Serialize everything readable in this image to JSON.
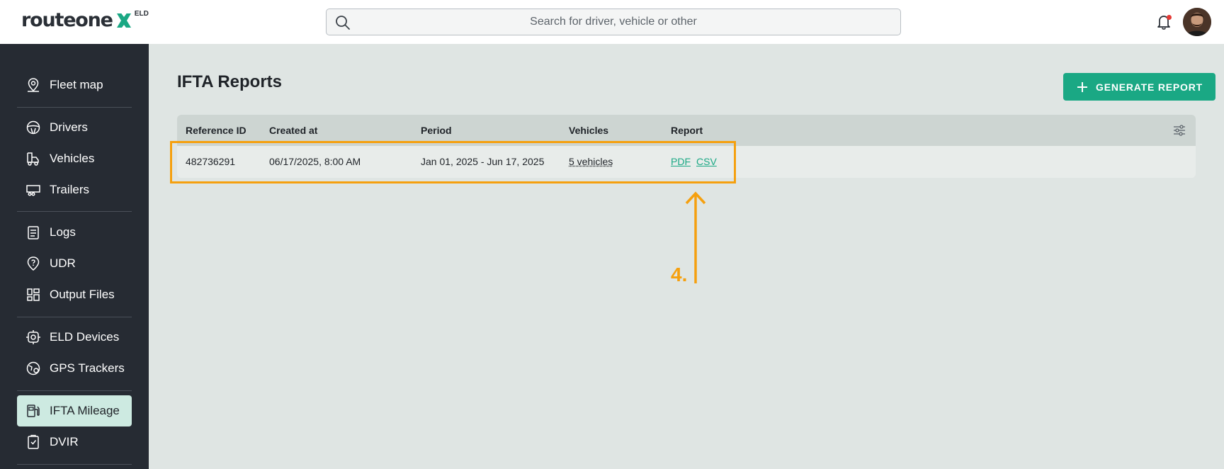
{
  "brand": {
    "name": "routeone",
    "suffix": "ELD"
  },
  "search": {
    "placeholder": "Search for driver, vehicle or other"
  },
  "sidebar": {
    "items": [
      {
        "label": "Fleet map",
        "icon": "map-pin-icon"
      },
      {
        "label": "Drivers",
        "icon": "steering-wheel-icon"
      },
      {
        "label": "Vehicles",
        "icon": "truck-icon"
      },
      {
        "label": "Trailers",
        "icon": "trailer-icon"
      },
      {
        "label": "Logs",
        "icon": "clipboard-icon"
      },
      {
        "label": "UDR",
        "icon": "question-pin-icon"
      },
      {
        "label": "Output Files",
        "icon": "grid-icon"
      },
      {
        "label": "ELD Devices",
        "icon": "device-gear-icon"
      },
      {
        "label": "GPS Trackers",
        "icon": "gps-tracker-icon"
      },
      {
        "label": "IFTA Mileage",
        "icon": "fuel-pump-icon",
        "active": true
      },
      {
        "label": "DVIR",
        "icon": "checklist-icon"
      }
    ]
  },
  "main": {
    "title": "IFTA Reports",
    "generate_button": "GENERATE REPORT",
    "table": {
      "columns": [
        "Reference ID",
        "Created at",
        "Period",
        "Vehicles",
        "Report"
      ],
      "rows": [
        {
          "reference_id": "482736291",
          "created_at": "06/17/2025, 8:00 AM",
          "period": "Jan 01, 2025 - Jun 17, 2025",
          "vehicles": "5 vehicles",
          "report_pdf": "PDF",
          "report_csv": "CSV"
        }
      ]
    }
  },
  "annotation": {
    "step": "4."
  },
  "colors": {
    "accent": "#1aa884",
    "sidebar": "#262b33",
    "highlight": "#f5a00f",
    "active_item": "#cdeae1"
  }
}
